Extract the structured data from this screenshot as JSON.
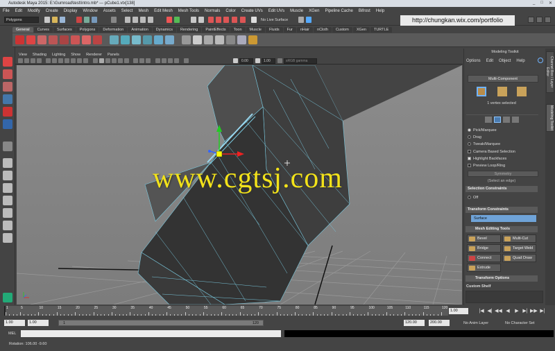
{
  "window": {
    "title": "Autodesk Maya 2015: E:\\Gumroad\\test\\Intro.mb*   ---   pCube1.vtx[138]",
    "controls": [
      "_",
      "□",
      "✕"
    ]
  },
  "menubar": [
    "File",
    "Edit",
    "Modify",
    "Create",
    "Display",
    "Window",
    "Assets",
    "Select",
    "Mesh",
    "Edit Mesh",
    "Mesh Tools",
    "Normals",
    "Color",
    "Create UVs",
    "Edit UVs",
    "Muscle",
    "XGen",
    "Pipeline Cache",
    "Bifrost",
    "Help"
  ],
  "statusline": {
    "mode": "Polygons",
    "live_surface": "No Live Surface"
  },
  "overlay_url": "http://chungkan.wix.com/portfolio",
  "shelf_tabs": [
    "General",
    "Curves",
    "Surfaces",
    "Polygons",
    "Deformation",
    "Animation",
    "Dynamics",
    "Rendering",
    "PaintEffects",
    "Toon",
    "Muscle",
    "Fluids",
    "Fur",
    "nHair",
    "nCloth",
    "Custom",
    "XGen",
    "TURTLE"
  ],
  "shelf_active": "General",
  "viewport_menu": [
    "View",
    "Shading",
    "Lighting",
    "Show",
    "Renderer",
    "Panels"
  ],
  "viewport_toolbar": {
    "field1": "0.00",
    "field2": "1.00",
    "color_space": "sRGB gamma"
  },
  "watermark": "www.cgtsj.com",
  "modeling_toolkit": {
    "title": "Modeling Toolkit",
    "menu": [
      "Options",
      "Edit",
      "Object",
      "Help"
    ],
    "multi_component": "Multi-Component",
    "selection_info": "1 vertex selected",
    "modes": [
      "Pick/Marquee",
      "Drag",
      "Tweak/Marquee"
    ],
    "options": [
      {
        "label": "Camera Based Selection",
        "checked": false
      },
      {
        "label": "Highlight Backfaces",
        "checked": true
      },
      {
        "label": "Preview Loop/Ring",
        "checked": false
      }
    ],
    "symmetry": "Symmetry",
    "select_edge": "(Select an edge)",
    "selection_constraints": "Selection Constraints",
    "sel_constraint_value": "Off",
    "transform_constraints": "Transform Constraints",
    "transform_constraint_value": "Surface",
    "mesh_editing_tools": "Mesh Editing Tools",
    "tools": [
      "Bevel",
      "Multi-Cut",
      "Bridge",
      "Target Weld",
      "Connect",
      "Quad Draw",
      "Extrude"
    ],
    "transform_options": "Transform Options",
    "custom_shelf": "Custom Shelf"
  },
  "side_tabs": [
    "Channel Box / Layer Editor",
    "Modeling Toolkit"
  ],
  "timeline": {
    "tick_labels": [
      "1",
      "5",
      "10",
      "15",
      "20",
      "25",
      "30",
      "35",
      "40",
      "45",
      "50",
      "55",
      "60",
      "65",
      "70",
      "75",
      "80",
      "85",
      "90",
      "95",
      "100",
      "105",
      "110",
      "115",
      "120"
    ],
    "current_frame": "1.00"
  },
  "range": {
    "start": "1.00",
    "inner_start": "1.00",
    "inner_marker": "1",
    "inner_end": "120",
    "end": "120.00",
    "max": "200.00",
    "anim_layer": "No Anim Layer",
    "char_set": "No Character Set"
  },
  "cmdline": {
    "label": "MEL"
  },
  "helpline": {
    "text": "Rotation:  106.00   -9.60"
  }
}
